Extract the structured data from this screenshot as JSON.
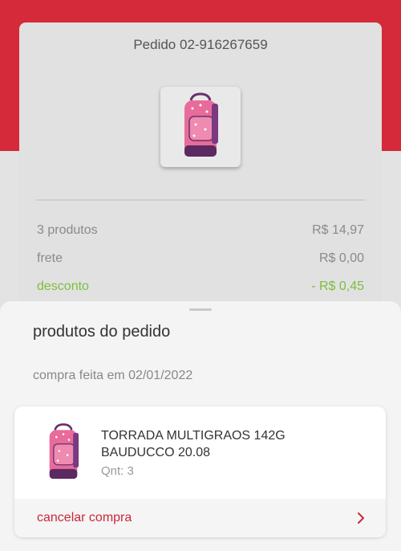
{
  "colors": {
    "brand_red": "#d42a3a",
    "discount_green": "#7cbf3c",
    "cancel_red": "#c8283a"
  },
  "order": {
    "number_label": "Pedido 02-916267659",
    "product_image_icon": "backpack-icon",
    "summary": [
      {
        "label": "3 produtos",
        "value": "R$ 14,97"
      },
      {
        "label": "frete",
        "value": "R$ 0,00"
      },
      {
        "label": "desconto",
        "value": "- R$ 0,45"
      }
    ]
  },
  "sheet": {
    "title": "produtos do pedido",
    "purchase_date": "compra feita em 02/01/2022",
    "product": {
      "name": "TORRADA MULTIGRAOS 142G BAUDUCCO 20.08",
      "quantity": "Qnt: 3",
      "image_icon": "backpack-icon"
    },
    "cancel_label": "cancelar compra",
    "cancel_icon": "chevron-right-icon"
  }
}
